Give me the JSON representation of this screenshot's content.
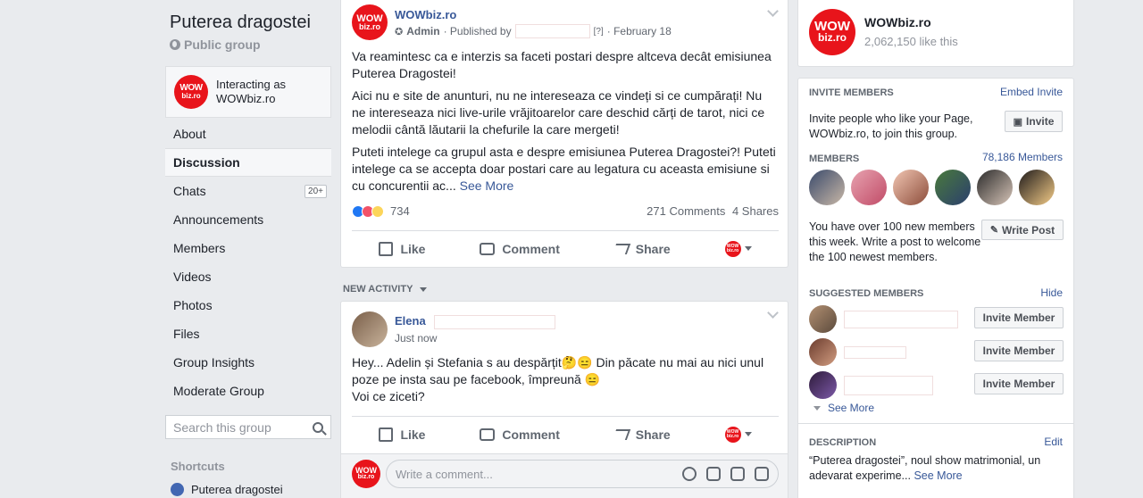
{
  "group": {
    "title": "Puterea dragostei",
    "privacy": "Public group",
    "interacting_line1": "Interacting as",
    "interacting_line2": "WOWbiz.ro"
  },
  "logo": {
    "line1": "WOW",
    "line2": "biz.ro"
  },
  "nav": [
    {
      "label": "About",
      "badge": ""
    },
    {
      "label": "Discussion",
      "badge": ""
    },
    {
      "label": "Chats",
      "badge": "20+"
    },
    {
      "label": "Announcements",
      "badge": ""
    },
    {
      "label": "Members",
      "badge": ""
    },
    {
      "label": "Videos",
      "badge": ""
    },
    {
      "label": "Photos",
      "badge": ""
    },
    {
      "label": "Files",
      "badge": ""
    },
    {
      "label": "Group Insights",
      "badge": ""
    },
    {
      "label": "Moderate Group",
      "badge": ""
    }
  ],
  "search": {
    "placeholder": "Search this group"
  },
  "shortcuts": {
    "heading": "Shortcuts",
    "item": "Puterea dragostei"
  },
  "post1": {
    "author": "WOWbiz.ro",
    "role": "Admin",
    "published_by": "· Published by",
    "help": "[?]",
    "date": "· February 18",
    "p1": "Va reamintesc ca e interzis sa faceti postari despre altceva decât emisiunea Puterea Dragostei!",
    "p2": "Aici nu e site de anunturi, nu ne intereseaza ce vindeți si ce cumpărați! Nu ne intereseaza nici live-urile vrăjitoarelor care deschid cărți de tarot, nici ce melodii cântă lăutarii la chefurile la care mergeti!",
    "p3": "Puteti intelege ca grupul asta e despre emisiunea Puterea Dragostei?! Puteti intelege ca se accepta doar postari care au legatura cu aceasta emisiune si cu concurentii ac...",
    "see_more": "See More",
    "reactions": "734",
    "comments": "271 Comments",
    "shares": "4 Shares"
  },
  "actions": {
    "like": "Like",
    "comment": "Comment",
    "share": "Share"
  },
  "new_activity": "NEW ACTIVITY",
  "post2": {
    "author": "Elena",
    "time": "Just now",
    "line1": "Hey... Adelin și Stefania s au despărțit🤔😑 Din păcate nu mai au nici unul poze pe insta sau pe facebook, împreună 😑",
    "line2": "Voi ce ziceti?",
    "comment_placeholder": "Write a comment..."
  },
  "page": {
    "name": "WOWbiz.ro",
    "likes": "2,062,150 like this"
  },
  "invite": {
    "heading": "INVITE MEMBERS",
    "embed": "Embed Invite",
    "text": "Invite people who like your Page, WOWbiz.ro, to join this group.",
    "button": "Invite"
  },
  "members": {
    "heading": "MEMBERS",
    "count": "78,186 Members",
    "new_text": "You have over 100 new members this week. Write a post to welcome the 100 newest members.",
    "write_post": "Write Post"
  },
  "suggested": {
    "heading": "SUGGESTED MEMBERS",
    "hide": "Hide",
    "button": "Invite Member",
    "see_more": "See More"
  },
  "description": {
    "heading": "DESCRIPTION",
    "edit": "Edit",
    "text": "“Puterea dragostei”, noul show matrimonial, un adevarat experime...",
    "see_more": "See More"
  }
}
